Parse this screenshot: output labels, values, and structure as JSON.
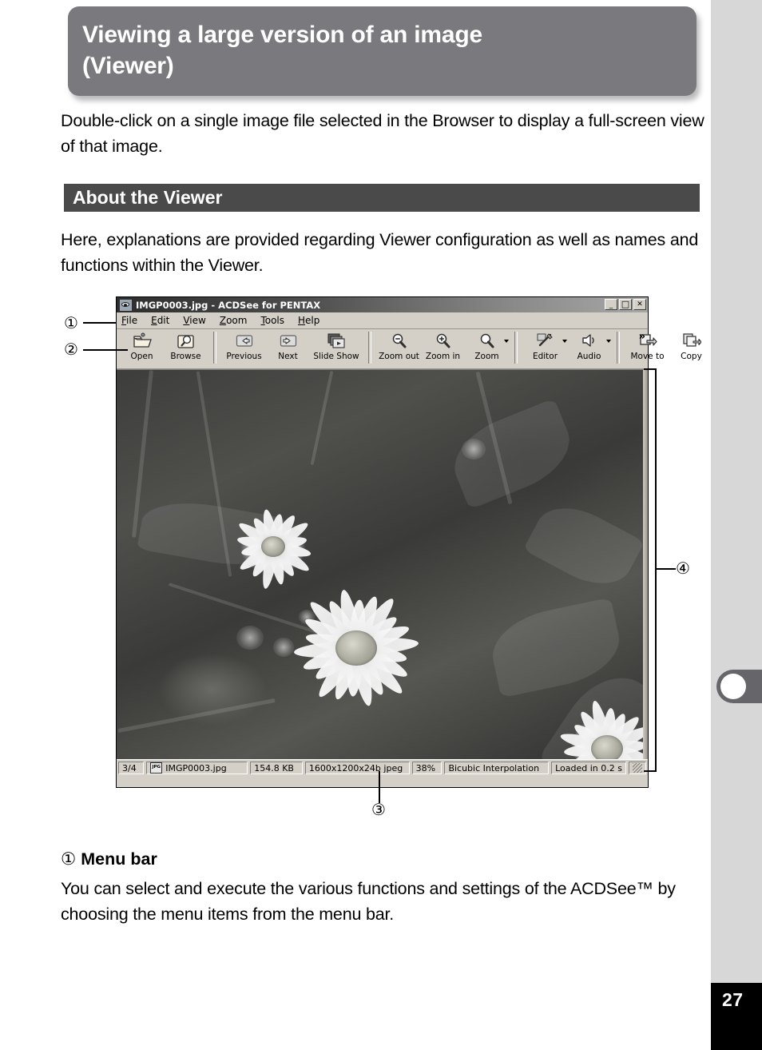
{
  "page": {
    "number": "27"
  },
  "banner": {
    "title_line1": "Viewing a large version of an image",
    "title_line2": "(Viewer)"
  },
  "intro": {
    "text": "Double-click on a single image file selected in the Browser to display a full-screen view of that image."
  },
  "section": {
    "heading": "About the Viewer",
    "description": "Here, explanations are provided regarding Viewer configuration as well as names and functions within the Viewer."
  },
  "app": {
    "titlebar": {
      "icon": "acdsee-eye-icon",
      "title": "IMGP0003.jpg - ACDSee for PENTAX",
      "minimize": "_",
      "maximize": "□",
      "close": "✕"
    },
    "menubar": [
      {
        "label": "File",
        "mnemonic": "F"
      },
      {
        "label": "Edit",
        "mnemonic": "E"
      },
      {
        "label": "View",
        "mnemonic": "V"
      },
      {
        "label": "Zoom",
        "mnemonic": "Z"
      },
      {
        "label": "Tools",
        "mnemonic": "T"
      },
      {
        "label": "Help",
        "mnemonic": "H"
      }
    ],
    "toolbar": {
      "groups": [
        [
          {
            "label": "Open",
            "icon": "open-folder-icon",
            "dropdown": false
          },
          {
            "label": "Browse",
            "icon": "browse-magnifier-icon",
            "dropdown": false
          }
        ],
        [
          {
            "label": "Previous",
            "icon": "arrow-left-icon",
            "dropdown": false
          },
          {
            "label": "Next",
            "icon": "arrow-right-icon",
            "dropdown": false
          },
          {
            "label": "Slide Show",
            "icon": "slide-show-icon",
            "dropdown": false
          }
        ],
        [
          {
            "label": "Zoom out",
            "icon": "zoom-out-icon",
            "dropdown": false
          },
          {
            "label": "Zoom in",
            "icon": "zoom-in-icon",
            "dropdown": false
          },
          {
            "label": "Zoom",
            "icon": "zoom-icon",
            "dropdown": true
          }
        ],
        [
          {
            "label": "Editor",
            "icon": "editor-wand-icon",
            "dropdown": true
          },
          {
            "label": "Audio",
            "icon": "audio-speaker-icon",
            "dropdown": true
          }
        ],
        [
          {
            "label": "Move to",
            "icon": "move-to-icon",
            "dropdown": false
          },
          {
            "label": "Copy",
            "icon": "copy-icon",
            "dropdown": false
          }
        ]
      ],
      "overflow": "»"
    },
    "statusbar": {
      "index": "3/4",
      "file_icon": "JPG",
      "filename": "IMGP0003.jpg",
      "filesize": "154.8 KB",
      "dimensions": "1600x1200x24b jpeg",
      "zoom": "38%",
      "interpolation": "Bicubic Interpolation",
      "load_time": "Loaded in 0.2 s"
    },
    "image_alt": "grayscale photograph of coreopsis daisy flowers"
  },
  "callouts": {
    "one": "①",
    "two": "②",
    "three": "③",
    "four": "④"
  },
  "definition": {
    "number": "①",
    "heading": "Menu bar",
    "body": "You can select and execute the various functions and settings of the ACDSee™ by choosing the menu items from the menu bar."
  },
  "colors": {
    "banner_bg": "#7a7a7e",
    "section_bg": "#4a4a4a",
    "sidebar_bg": "#d7d7d7",
    "tab_bg": "#66666a",
    "window_chrome": "#d4d0c8"
  }
}
